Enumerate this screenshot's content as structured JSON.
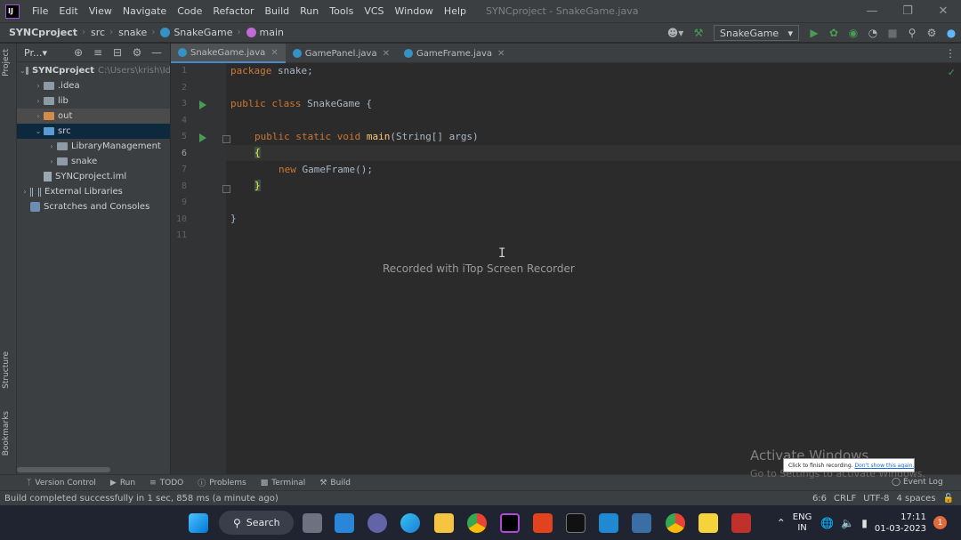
{
  "menubar": {
    "items": [
      "File",
      "Edit",
      "View",
      "Navigate",
      "Code",
      "Refactor",
      "Build",
      "Run",
      "Tools",
      "VCS",
      "Window",
      "Help"
    ],
    "window_title": "SYNCproject - SnakeGame.java"
  },
  "navbar": {
    "breadcrumbs": [
      "SYNCproject",
      "src",
      "snake",
      "SnakeGame",
      "main"
    ],
    "run_config": "SnakeGame"
  },
  "left_strip": {
    "project_tab": "Project",
    "structure_tab": "Structure",
    "bookmarks_tab": "Bookmarks"
  },
  "project": {
    "title": "Pr...",
    "tree": [
      {
        "label": "SYNCproject",
        "extra": "C:\\Users\\krish\\Id",
        "level": 0,
        "expanded": true,
        "kind": "project"
      },
      {
        "label": ".idea",
        "level": 1,
        "expanded": false,
        "kind": "folder"
      },
      {
        "label": "lib",
        "level": 1,
        "expanded": false,
        "kind": "folder"
      },
      {
        "label": "out",
        "level": 1,
        "expanded": false,
        "kind": "folder-orange"
      },
      {
        "label": "src",
        "level": 1,
        "expanded": true,
        "kind": "folder-blue"
      },
      {
        "label": "LibraryManagement",
        "level": 2,
        "expanded": false,
        "kind": "folder"
      },
      {
        "label": "snake",
        "level": 2,
        "expanded": false,
        "kind": "folder"
      },
      {
        "label": "SYNCproject.iml",
        "level": 1,
        "kind": "file"
      },
      {
        "label": "External Libraries",
        "level": 0,
        "expanded": false,
        "kind": "lib"
      },
      {
        "label": "Scratches and Consoles",
        "level": 0,
        "kind": "scratch"
      }
    ]
  },
  "editor": {
    "tabs": [
      {
        "label": "SnakeGame.java",
        "active": true
      },
      {
        "label": "GamePanel.java",
        "active": false
      },
      {
        "label": "GameFrame.java",
        "active": false
      }
    ],
    "line_numbers": [
      "1",
      "2",
      "3",
      "4",
      "5",
      "6",
      "7",
      "8",
      "9",
      "10",
      "11"
    ],
    "current_line": 6,
    "code": {
      "l1_kw": "package",
      "l1_rest": " snake;",
      "l3_kw": "public class",
      "l3_rest": " SnakeGame {",
      "l5_kw": "public static void",
      "l5_fn": "main",
      "l5_rest": "(String[] args)",
      "l6_brace": "{",
      "l7_kw": "new",
      "l7_rest": " GameFrame();",
      "l8_brace": "}",
      "l10_brace": "}"
    },
    "watermark": "Recorded with iTop Screen Recorder"
  },
  "bottom_tools": [
    "Version Control",
    "Run",
    "TODO",
    "Problems",
    "Terminal",
    "Build"
  ],
  "event_log": "Event Log",
  "status": {
    "message": "Build completed successfully in 1 sec, 858 ms (a minute ago)",
    "position": "6:6",
    "line_sep": "CRLF",
    "encoding": "UTF-8",
    "indent": "4 spaces"
  },
  "overlay": {
    "activate_title": "Activate Windows",
    "activate_sub": "Go to Settings to activate Windows.",
    "rec_popup_text": "Click to finish recording.",
    "rec_popup_link": "Don't show this again."
  },
  "taskbar": {
    "search_label": "Search",
    "lang_line1": "ENG",
    "lang_line2": "IN",
    "time": "17:11",
    "date": "01-03-2023",
    "notification_count": "1"
  },
  "colors": {
    "accent_blue": "#4a88c7",
    "run_green": "#499c54",
    "keyword": "#cc7832",
    "function": "#ffc66d"
  }
}
